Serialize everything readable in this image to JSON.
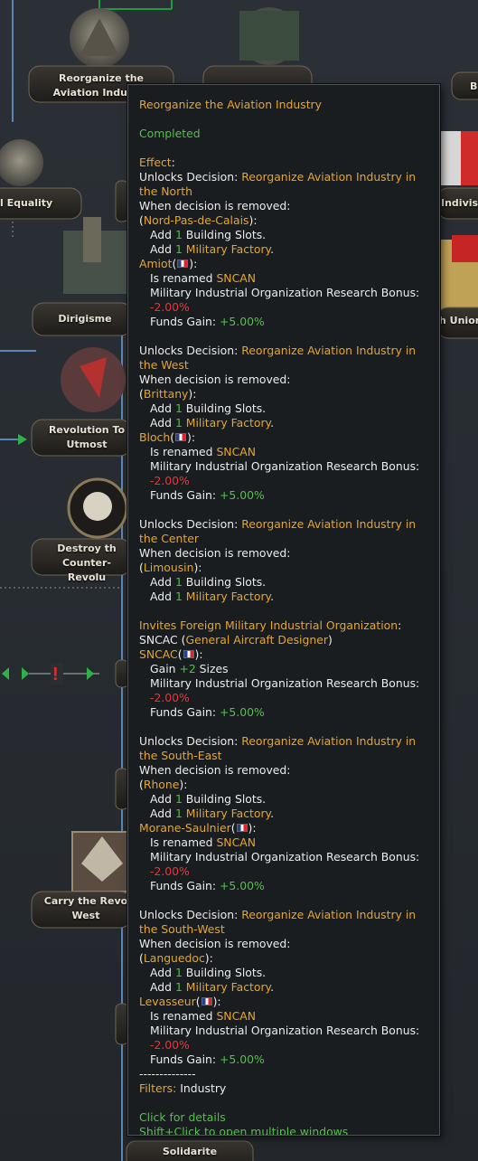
{
  "focus_tree": {
    "nodes": [
      {
        "id": "reorganize",
        "label": "Reorganize the Aviation Industry",
        "icon": "aviation-wrench-icon"
      },
      {
        "id": "top-right",
        "label": "",
        "icon": "industry-factory-icon"
      },
      {
        "id": "equality",
        "label": "l Equality",
        "icon": "handshake-icon"
      },
      {
        "id": "dirigisme",
        "label": "Dirigisme",
        "icon": "factory-city-icon"
      },
      {
        "id": "revolution-utmost",
        "label": "Revolution To Utmost",
        "icon": "red-flag-icon"
      },
      {
        "id": "destroy",
        "label": "Destroy th Counter-Revolu",
        "icon": "skull-icon"
      },
      {
        "id": "carry-west",
        "label": "Carry the Revo West",
        "icon": "eagle-icon"
      },
      {
        "id": "indivisi",
        "label": "Indivisi",
        "icon": "french-flag-icon"
      },
      {
        "id": "union",
        "label": "h Union",
        "icon": "french-crest-icon"
      },
      {
        "id": "solidarite",
        "label": "Solidarite",
        "icon": ""
      },
      {
        "id": "edge-b",
        "label": "B",
        "icon": ""
      }
    ]
  },
  "tooltip": {
    "title": "Reorganize the Aviation Industry",
    "status": "Completed",
    "effect_label": "Effect",
    "decisions": [
      {
        "prefix": "Unlocks Decision: ",
        "name_line1": "Reorganize Aviation Industry in",
        "name_line2": "the North",
        "when_removed": "When decision is removed:",
        "state": "Nord-Pas-de-Calais",
        "building_slots": "1",
        "military_factory": "1",
        "company": "Amiot",
        "renamed_to": "SNCAN",
        "research_bonus": "-2.00%",
        "funds_gain": "+5.00%"
      },
      {
        "prefix": "Unlocks Decision: ",
        "name_line1": "Reorganize Aviation Industry in",
        "name_line2": "the West",
        "when_removed": "When decision is removed:",
        "state": "Brittany",
        "building_slots": "1",
        "military_factory": "1",
        "company": "Bloch",
        "renamed_to": "SNCAN",
        "research_bonus": "-2.00%",
        "funds_gain": "+5.00%"
      },
      {
        "prefix": "Unlocks Decision: ",
        "name_line1": "Reorganize Aviation Industry in",
        "name_line2": "the Center",
        "when_removed": "When decision is removed:",
        "state": "Limousin",
        "building_slots": "1",
        "military_factory": "1"
      },
      {
        "prefix": "Unlocks Decision: ",
        "name_line1": "Reorganize Aviation Industry in",
        "name_line2": "the South-East",
        "when_removed": "When decision is removed:",
        "state": "Rhone",
        "building_slots": "1",
        "military_factory": "1",
        "company": "Morane-Saulnier",
        "renamed_to": "SNCAN",
        "research_bonus": "-2.00%",
        "funds_gain": "+5.00%"
      },
      {
        "prefix": "Unlocks Decision: ",
        "name_line1": "Reorganize Aviation Industry in",
        "name_line2": "the South-West",
        "when_removed": "When decision is removed:",
        "state": "Languedoc",
        "building_slots": "1",
        "military_factory": "1",
        "company": "Levasseur",
        "renamed_to": "SNCAN",
        "research_bonus": "-2.00%",
        "funds_gain": "+5.00%"
      }
    ],
    "mio": {
      "invites": "Invites Foreign Military Industrial Organization",
      "name": "SNCAC",
      "type": "General Aircraft Designer",
      "gain_sizes": "+2",
      "research_bonus": "-2.00%",
      "funds_gain": "+5.00%"
    },
    "text": {
      "add": "Add ",
      "building_slots": " Building Slots.",
      "military_factory": "Military Factory",
      "is_renamed": "Is renamed ",
      "research_bonus_label": "Military Industrial Organization Research Bonus:",
      "funds_gain_label": "Funds Gain: ",
      "gain": "Gain ",
      "sizes": " Sizes"
    },
    "separator": "--------------",
    "filters_label": "Filters:",
    "filters_value": "Industry",
    "click_details": "Click for details",
    "shift_click": "Shift+Click to open multiple windows"
  },
  "colors": {
    "title": "#e8a52a",
    "positive": "#4fc345",
    "negative": "#e8363a",
    "text": "#ececec",
    "panel": "#1a1d20",
    "background": "#2c3037"
  }
}
